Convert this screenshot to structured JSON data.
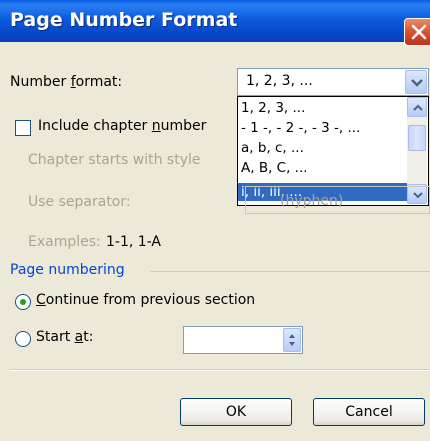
{
  "dialog": {
    "title": "Page Number Format"
  },
  "number_format": {
    "label_prefix": "Number ",
    "label_underlined": "f",
    "label_suffix": "ormat:",
    "selected_value": "1, 2, 3, ...",
    "options": [
      {
        "label": "1, 2, 3, ...",
        "selected": false
      },
      {
        "label": "- 1 -, - 2 -, - 3 -, ...",
        "selected": false
      },
      {
        "label": "a, b, c, ...",
        "selected": false
      },
      {
        "label": "A, B, C, ...",
        "selected": false
      },
      {
        "label": "i, ii, iii, ...",
        "selected": true
      }
    ]
  },
  "include_chapter": {
    "label_prefix": "Include chapter ",
    "label_underlined": "n",
    "label_suffix": "umber",
    "checked": false
  },
  "chapter_style": {
    "label": "Chapter starts with style"
  },
  "separator": {
    "label": "Use separator:",
    "partial_value": "(hyphen)"
  },
  "examples": {
    "label": "Examples:",
    "value": "1-1, 1-A"
  },
  "page_numbering": {
    "group_label": "Page numbering",
    "continue_prefix": "",
    "continue_underlined": "C",
    "continue_suffix": "ontinue from previous section",
    "continue_selected": true,
    "start_prefix": "Start ",
    "start_underlined": "a",
    "start_suffix": "t:",
    "start_value": ""
  },
  "buttons": {
    "ok": "OK",
    "cancel": "Cancel"
  },
  "colors": {
    "title_bar": "#0a5fe4",
    "dialog_bg": "#ece9d8",
    "selection": "#316ac5",
    "group_label": "#0046d5",
    "close_button": "#d4492a"
  }
}
